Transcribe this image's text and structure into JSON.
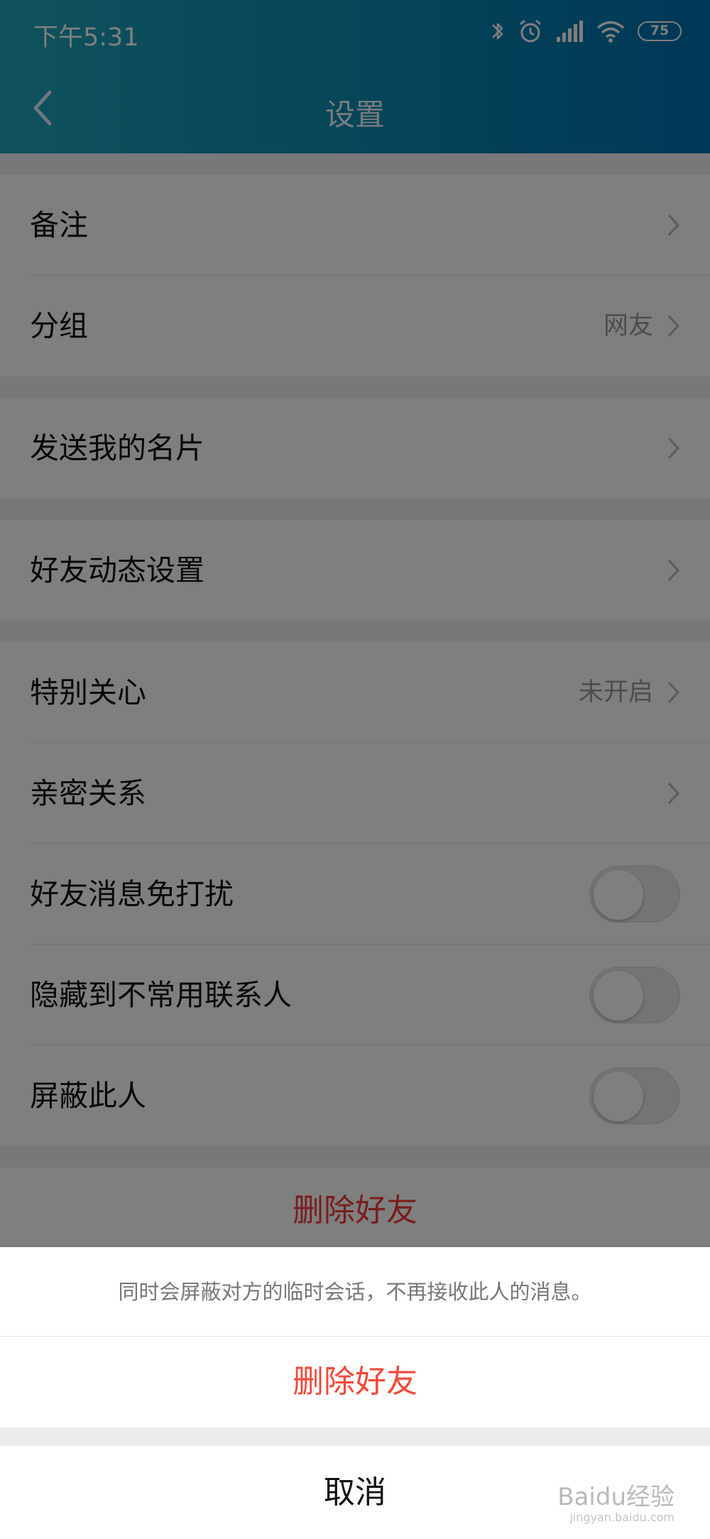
{
  "status_bar": {
    "time": "下午5:31",
    "battery": "75"
  },
  "header": {
    "title": "设置"
  },
  "groups": [
    [
      {
        "label": "备注",
        "value": "",
        "control": "chevron"
      },
      {
        "label": "分组",
        "value": "网友",
        "control": "chevron"
      }
    ],
    [
      {
        "label": "发送我的名片",
        "value": "",
        "control": "chevron"
      }
    ],
    [
      {
        "label": "好友动态设置",
        "value": "",
        "control": "chevron"
      }
    ],
    [
      {
        "label": "特别关心",
        "value": "未开启",
        "control": "chevron"
      },
      {
        "label": "亲密关系",
        "value": "",
        "control": "chevron"
      },
      {
        "label": "好友消息免打扰",
        "value": "",
        "control": "toggle",
        "on": false
      },
      {
        "label": "隐藏到不常用联系人",
        "value": "",
        "control": "toggle",
        "on": false
      },
      {
        "label": "屏蔽此人",
        "value": "",
        "control": "toggle",
        "on": false
      }
    ]
  ],
  "delete_button": "删除好友",
  "action_sheet": {
    "description": "同时会屏蔽对方的临时会话，不再接收此人的消息。",
    "confirm_label": "删除好友",
    "cancel_label": "取消"
  },
  "watermark": {
    "logo": "Baidu经验",
    "site": "jingyan.baidu.com"
  },
  "colors": {
    "header_start": "#1fa3b8",
    "header_end": "#0070b0",
    "danger": "#f5483a"
  }
}
